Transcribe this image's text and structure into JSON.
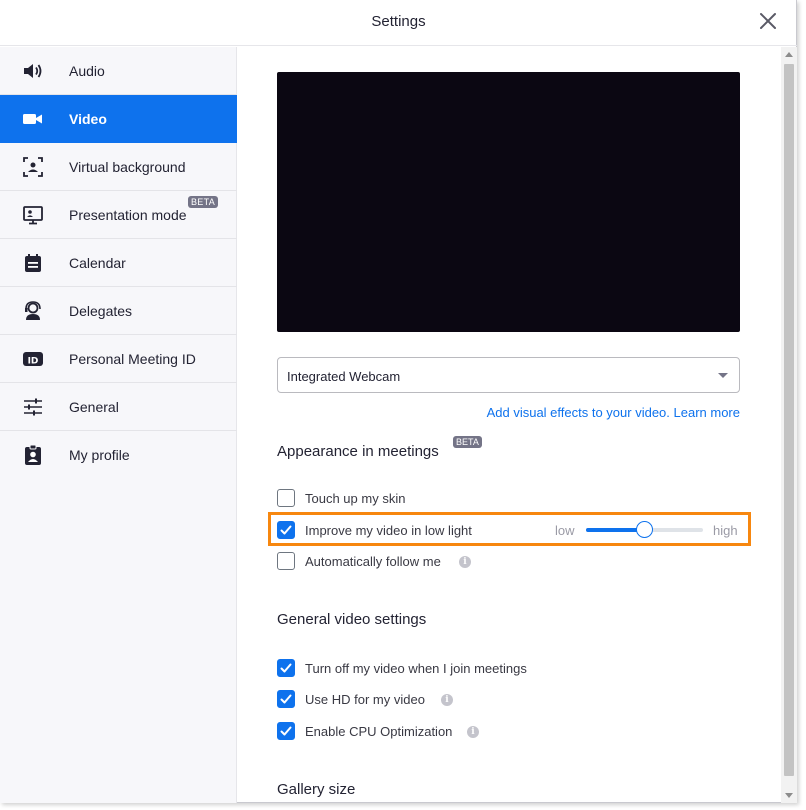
{
  "window": {
    "title": "Settings"
  },
  "sidebar": {
    "items": [
      {
        "label": "Audio",
        "icon": "speaker-icon",
        "active": false
      },
      {
        "label": "Video",
        "icon": "video-camera-icon",
        "active": true
      },
      {
        "label": "Virtual background",
        "icon": "virtual-background-icon",
        "active": false
      },
      {
        "label": "Presentation mode",
        "icon": "presentation-icon",
        "active": false,
        "badge": "BETA"
      },
      {
        "label": "Calendar",
        "icon": "calendar-icon",
        "active": false
      },
      {
        "label": "Delegates",
        "icon": "delegates-icon",
        "active": false
      },
      {
        "label": "Personal Meeting ID",
        "icon": "id-badge-icon",
        "active": false
      },
      {
        "label": "General",
        "icon": "sliders-icon",
        "active": false
      },
      {
        "label": "My profile",
        "icon": "profile-icon",
        "active": false
      }
    ]
  },
  "video": {
    "camera_select": {
      "value": "Integrated Webcam"
    },
    "effects_link": "Add visual effects to your video.",
    "learn_more_link": "Learn more",
    "appearance": {
      "title": "Appearance in meetings",
      "badge": "BETA",
      "touch_up": {
        "label": "Touch up my skin",
        "checked": false
      },
      "low_light": {
        "label": "Improve my video in low light",
        "checked": true,
        "low_label": "low",
        "high_label": "high",
        "level": 0.5
      },
      "follow_me": {
        "label": "Automatically follow me",
        "checked": false
      }
    },
    "general": {
      "title": "General video settings",
      "turn_off": {
        "label": "Turn off my video when I join meetings",
        "checked": true
      },
      "use_hd": {
        "label": "Use HD for my video",
        "checked": true
      },
      "cpu_opt": {
        "label": "Enable CPU Optimization",
        "checked": true
      }
    },
    "gallery": {
      "title": "Gallery size"
    }
  },
  "colors": {
    "accent": "#0e72ed",
    "highlight": "#f7870f",
    "preview_bg": "#0b0712"
  }
}
